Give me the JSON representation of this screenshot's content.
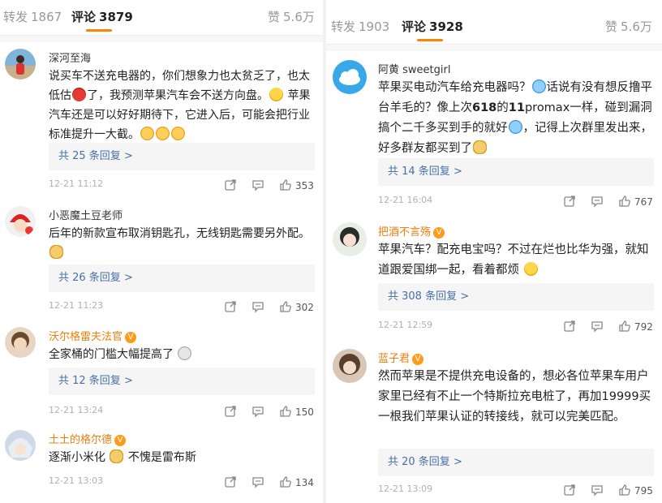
{
  "left": {
    "tabs": [
      {
        "label": "转发",
        "count": "1867"
      },
      {
        "label": "评论",
        "count": "3879"
      },
      {
        "label": "赞",
        "count": "5.6万"
      }
    ],
    "comments": [
      {
        "name": "深河至海",
        "text": "说买车不送充电器的，你们想象力也太贫乏了，也太低估🍎了，我预测苹果汽车会不送方向盘。😂 苹果汽车还是可以好好期待下，它进入后，可能会把行业标准提升一大截。😋😋😋",
        "replies": "共 25 条回复 >",
        "time": "12-21 11:12",
        "likes": "353"
      },
      {
        "name": "小恶魔土豆老师",
        "text": "后年的新款宣布取消钥匙孔，无线钥匙需要另外配。🐶",
        "replies": "共 26 条回复 >",
        "time": "12-21 11:23",
        "likes": "302"
      },
      {
        "name": "沃尔格雷夫法官",
        "text": "全家桶的门槛大幅提高了 😱",
        "replies": "共 12 条回复 >",
        "time": "12-21 13:24",
        "likes": "150"
      },
      {
        "name": "土土的格尔德",
        "text": "逐渐小米化 🐶 不愧是雷布斯",
        "replies": "",
        "time": "12-21 13:03",
        "likes": "134"
      }
    ]
  },
  "right": {
    "tabs": [
      {
        "label": "转发",
        "count": "1903"
      },
      {
        "label": "评论",
        "count": "3928"
      },
      {
        "label": "赞",
        "count": "5.6万"
      }
    ],
    "comments": [
      {
        "name": "阿黄 sweetgirl",
        "text": "苹果买电动汽车给充电器吗？😂话说有没有想反撸平台羊毛的？像上次618的11promax一样，碰到漏洞搞个二千多买到手的就好😂，记得上次群里发出来，好多群友都买到了🐶",
        "replies": "共 14 条回复 >",
        "time": "12-21 16:04",
        "likes": "767"
      },
      {
        "name": "把酒不言殇",
        "text": "苹果汽车？配充电宝吗？不过在烂也比华为强，就知道跟爱国绑一起，看着都烦 🙄",
        "replies": "共 308 条回复 >",
        "time": "12-21 12:59",
        "likes": "792"
      },
      {
        "name": "蓝子君",
        "text": "然而苹果是不提供充电设备的，想必各位苹果车用户家里已经有不止一个特斯拉充电桩了，再加19999买一根我们苹果认证的转接线，就可以完美匹配。",
        "replies": "共 20 条回复 >",
        "time": "12-21 13:09",
        "likes": "795"
      }
    ]
  }
}
